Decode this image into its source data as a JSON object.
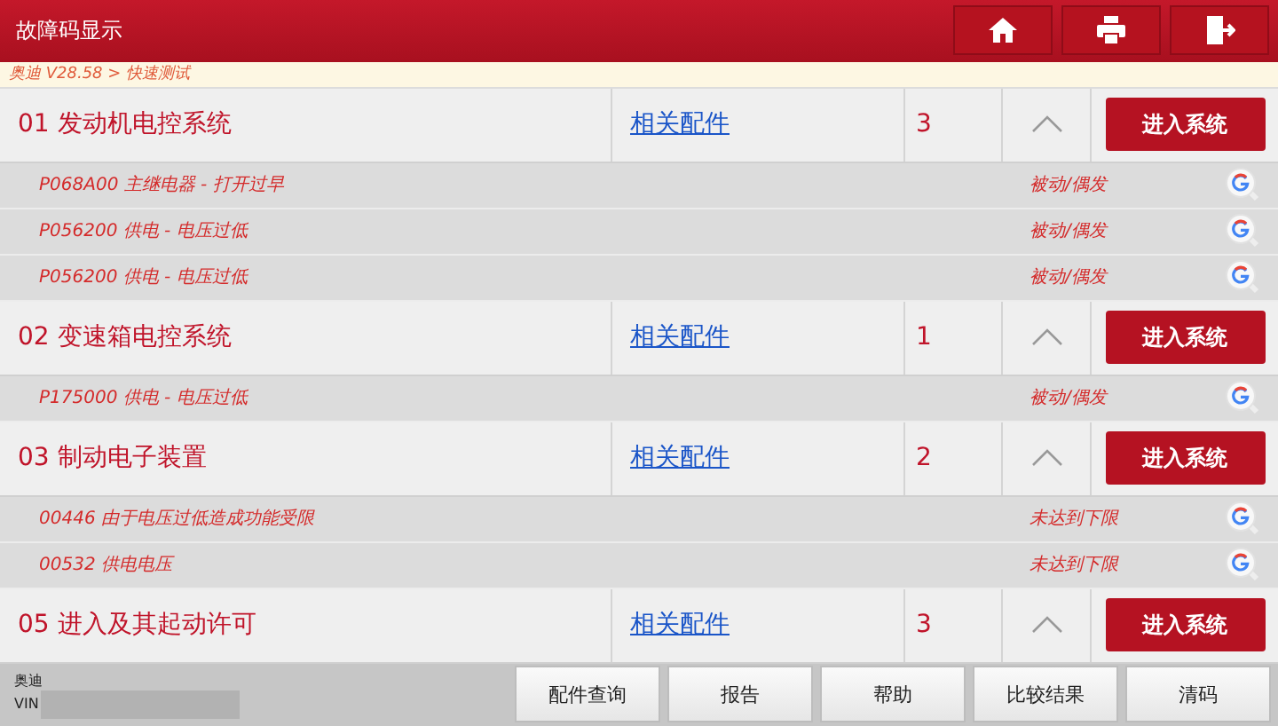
{
  "header": {
    "title": "故障码显示",
    "buttons": [
      {
        "kind": "home"
      },
      {
        "kind": "print"
      },
      {
        "kind": "exit"
      }
    ]
  },
  "breadcrumb": "奥迪 V28.58 > 快速测试",
  "systems": [
    {
      "name": "01 发动机电控系统",
      "parts_link": "相关配件",
      "count": "3",
      "expanded": true,
      "button": "进入系统",
      "faults": [
        {
          "code": "P068A00 主继电器 - 打开过早",
          "status": "被动/偶发"
        },
        {
          "code": "P056200 供电 - 电压过低",
          "status": "被动/偶发"
        },
        {
          "code": "P056200 供电 - 电压过低",
          "status": "被动/偶发"
        }
      ]
    },
    {
      "name": "02 变速箱电控系统",
      "parts_link": "相关配件",
      "count": "1",
      "expanded": true,
      "button": "进入系统",
      "faults": [
        {
          "code": "P175000 供电 - 电压过低",
          "status": "被动/偶发"
        }
      ]
    },
    {
      "name": "03 制动电子装置",
      "parts_link": "相关配件",
      "count": "2",
      "expanded": true,
      "button": "进入系统",
      "faults": [
        {
          "code": "00446 由于电压过低造成功能受限",
          "status": "未达到下限"
        },
        {
          "code": "00532 供电电压",
          "status": "未达到下限"
        }
      ]
    },
    {
      "name": "05 进入及其起动许可",
      "parts_link": "相关配件",
      "count": "3",
      "expanded": true,
      "button": "进入系统"
    }
  ],
  "footer": {
    "vehicle": "奥迪",
    "vin_label": "VIN",
    "buttons": [
      "配件查询",
      "报告",
      "帮助",
      "比较结果",
      "清码"
    ]
  }
}
